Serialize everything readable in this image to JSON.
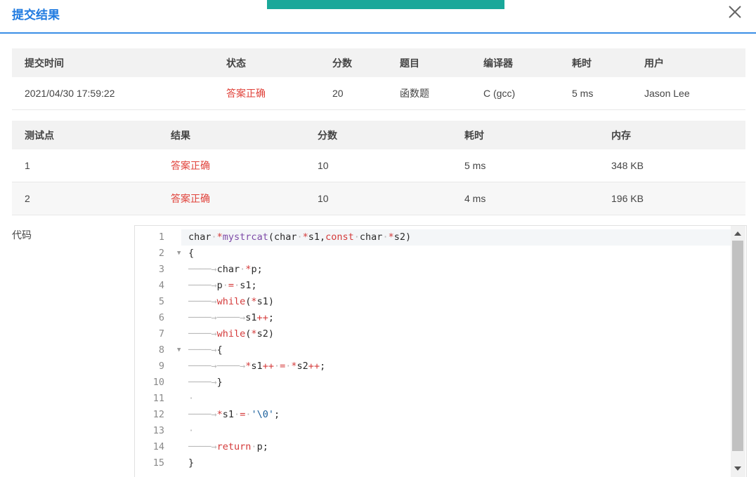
{
  "dialog": {
    "title": "提交结果"
  },
  "summary": {
    "headers": [
      "提交时间",
      "状态",
      "分数",
      "题目",
      "编译器",
      "耗时",
      "用户"
    ],
    "row": [
      "2021/04/30 17:59:22",
      "答案正确",
      "20",
      "函数题",
      "C (gcc)",
      "5 ms",
      "Jason Lee"
    ]
  },
  "tests": {
    "headers": [
      "测试点",
      "结果",
      "分数",
      "耗时",
      "内存"
    ],
    "rows": [
      [
        "1",
        "答案正确",
        "10",
        "5 ms",
        "348 KB"
      ],
      [
        "2",
        "答案正确",
        "10",
        "4 ms",
        "196 KB"
      ]
    ]
  },
  "code": {
    "label": "代码",
    "line_numbers": [
      "1",
      "2",
      "3",
      "4",
      "5",
      "6",
      "7",
      "8",
      "9",
      "10",
      "11",
      "12",
      "13",
      "14",
      "15"
    ],
    "lines": [
      "char *mystrcat(char *s1,const char *s2)",
      "{",
      "\tchar *p;",
      "\tp = s1;",
      "\twhile(*s1)",
      "\t\ts1++;",
      "\twhile(*s2)",
      "\t{",
      "\t\t*s1++ = *s2++;",
      "\t}",
      "",
      "\t*s1 = '\\0';",
      "",
      "\treturn p;",
      "}"
    ]
  },
  "colors": {
    "accent": "#1f7ae0",
    "ok": "#e0423a",
    "teal": "#1aa89a"
  }
}
